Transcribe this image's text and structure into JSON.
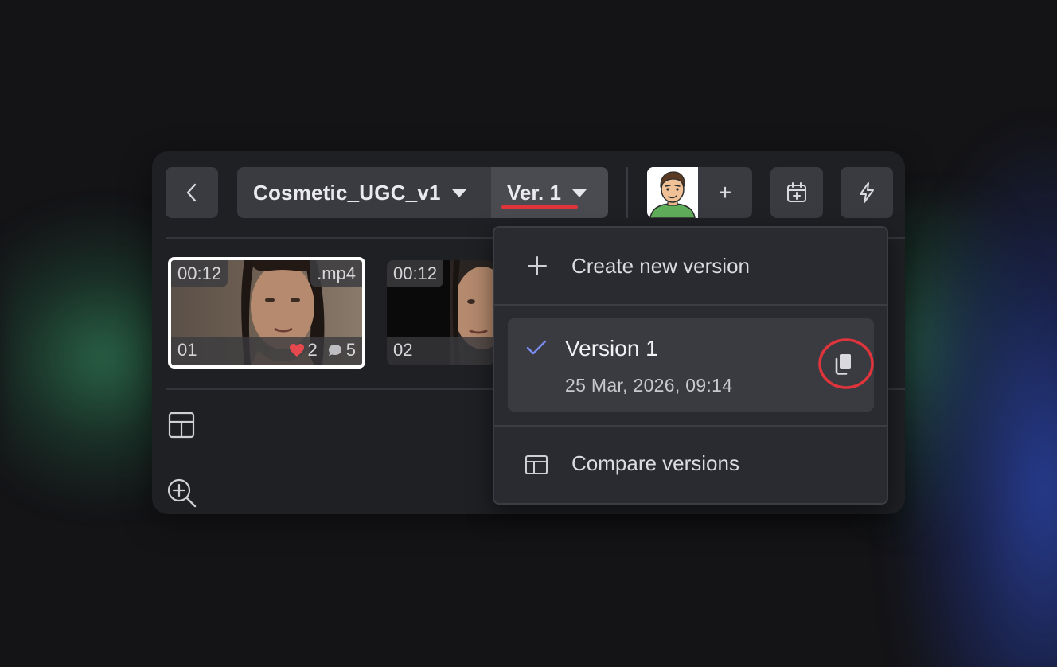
{
  "project": {
    "title": "Cosmetic_UGC_v1",
    "version_label": "Ver. 1"
  },
  "header": {
    "add_member_label": "+"
  },
  "thumbnails": [
    {
      "duration": "00:12",
      "format": ".mp4",
      "index": "01",
      "likes": "2",
      "comments": "5",
      "selected": true
    },
    {
      "duration": "00:12",
      "index": "02",
      "selected": false
    }
  ],
  "version_menu": {
    "create_label": "Create new version",
    "versions": [
      {
        "name": "Version 1",
        "date": "25 Mar, 2026, 09:14",
        "current": true
      }
    ],
    "compare_label": "Compare versions"
  },
  "colors": {
    "accent_check": "#7b8cf0",
    "annotation_red": "#e0343c",
    "heart": "#e5484d"
  },
  "icons": [
    "chevron-left-icon",
    "caret-down-icon",
    "plus-icon",
    "calendar-add-icon",
    "bolt-icon",
    "heart-icon",
    "comment-icon",
    "layout-icon",
    "zoom-in-icon",
    "check-icon",
    "copy-icon",
    "compare-icon"
  ]
}
